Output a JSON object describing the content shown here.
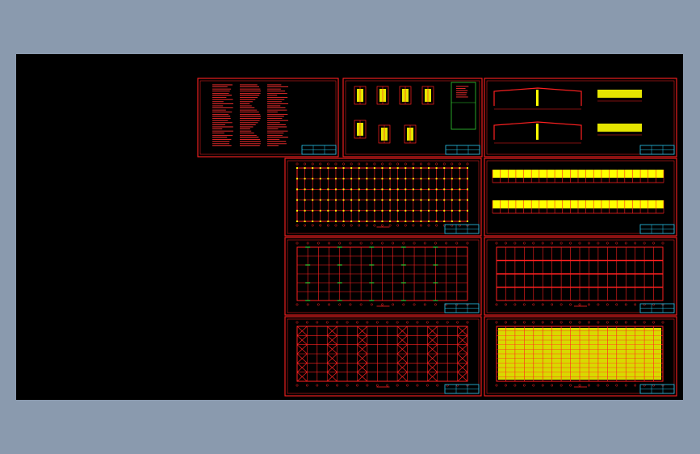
{
  "app": {
    "viewport_bg": "#000000",
    "surround_bg": "#8a9aae"
  },
  "colors": {
    "frame": "#ff2020",
    "title_block": "#28c8f0",
    "fill": "#ffff00",
    "accent": "#32cd32",
    "text": "#ff3030"
  },
  "sheets": [
    {
      "id": "sheet-design-notes",
      "type": "notes"
    },
    {
      "id": "sheet-node-details",
      "type": "details"
    },
    {
      "id": "sheet-frame-elevations",
      "type": "elevations"
    },
    {
      "id": "sheet-plan-a",
      "type": "grid-plan"
    },
    {
      "id": "sheet-long-elevations",
      "type": "long-elevations"
    },
    {
      "id": "sheet-plan-b",
      "type": "grid-plan-green"
    },
    {
      "id": "sheet-roof-plan",
      "type": "roof-plan"
    },
    {
      "id": "sheet-bracing-plan",
      "type": "bracing-plan"
    },
    {
      "id": "sheet-purlin-plan",
      "type": "purlin-plan"
    }
  ]
}
